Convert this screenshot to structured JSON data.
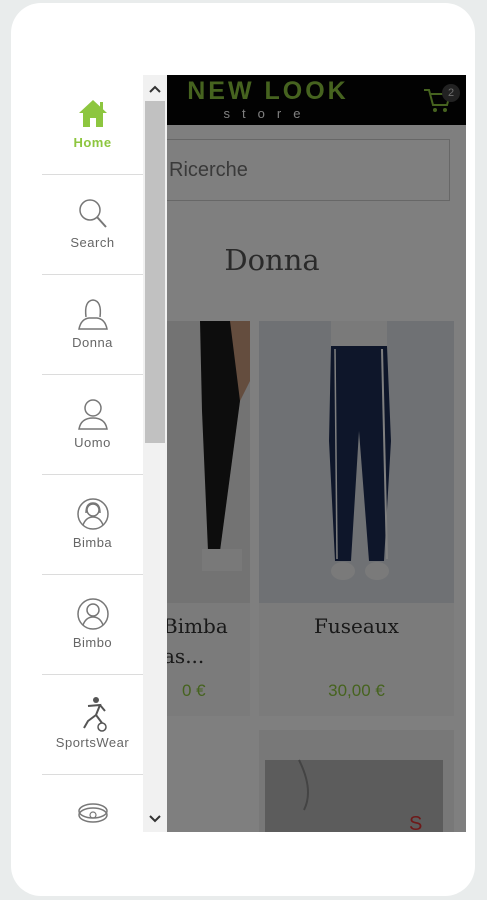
{
  "header": {
    "logo_title": "NEW LOOK",
    "logo_subtitle": "store",
    "cart_count": "2"
  },
  "search": {
    "placeholder": "Ricerche"
  },
  "category": {
    "title": "Donna"
  },
  "products": [
    {
      "name": "Bimba\nas...",
      "price": "0 €"
    },
    {
      "name": "Fuseaux",
      "price": "30,00 €"
    }
  ],
  "menu": {
    "items": [
      {
        "label": "Home",
        "icon": "home-icon",
        "active": true
      },
      {
        "label": "Search",
        "icon": "search-icon"
      },
      {
        "label": "Donna",
        "icon": "woman-icon"
      },
      {
        "label": "Uomo",
        "icon": "man-icon"
      },
      {
        "label": "Bimba",
        "icon": "girl-icon"
      },
      {
        "label": "Bimbo",
        "icon": "boy-icon"
      },
      {
        "label": "SportsWear",
        "icon": "soccer-player-icon"
      },
      {
        "label": "",
        "icon": "accessory-icon"
      }
    ]
  },
  "colors": {
    "accent": "#8dc63f",
    "header_bg": "#050505"
  }
}
